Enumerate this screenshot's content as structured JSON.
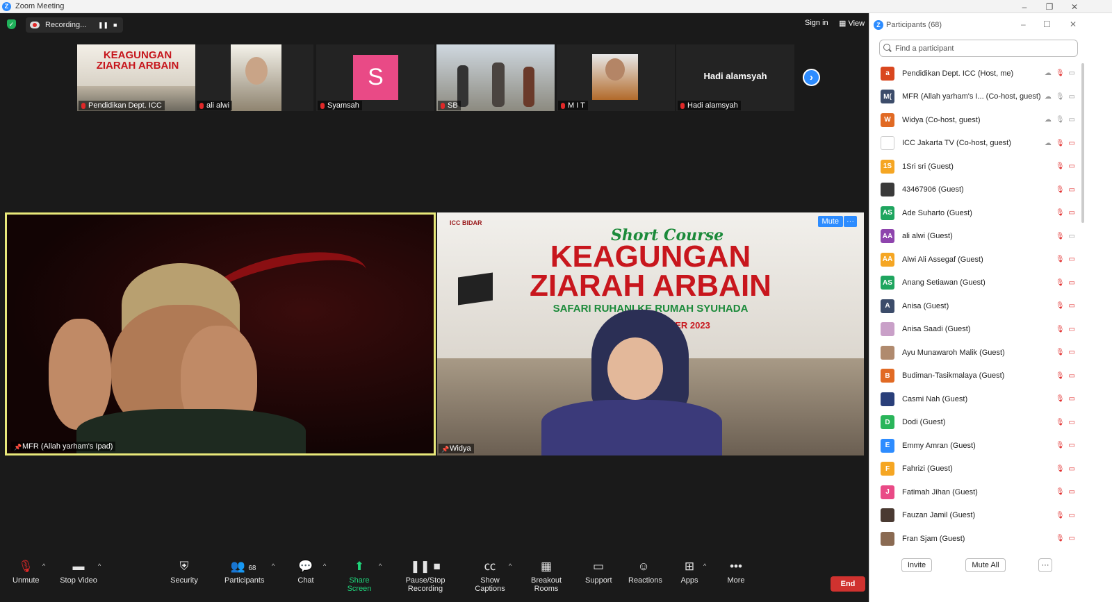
{
  "window": {
    "title": "Zoom Meeting"
  },
  "topbar": {
    "recording_label": "Recording...",
    "sign_in": "Sign in",
    "view": "View"
  },
  "strip_tiles": [
    {
      "name": "Pendidikan Dept. ICC",
      "banner_title": "KEAGUNGAN ZIARAH ARBAIN"
    },
    {
      "name": "ali alwi"
    },
    {
      "name": "Syamsah",
      "initial": "S",
      "color": "#e94a86"
    },
    {
      "name": "SB"
    },
    {
      "name": "M I T"
    },
    {
      "name": "Hadi alamsyah"
    }
  ],
  "speakers": {
    "left": {
      "name": "MFR (Allah yarham's Ipad)"
    },
    "right": {
      "name": "Widya",
      "mute_label": "Mute",
      "more_label": "···",
      "banner": {
        "logo": "ICC BIDAR",
        "script": "Short Course",
        "line1": "KEAGUNGAN",
        "line2": "ZIARAH ARBAIN",
        "subtitle": "SAFARI RUHANI KE RUMAH SYUHADA",
        "date": "MBER 2023"
      }
    }
  },
  "toolbar": {
    "unmute": "Unmute",
    "stop_video": "Stop Video",
    "security": "Security",
    "participants": "Participants",
    "participants_count": "68",
    "chat": "Chat",
    "share_screen": "Share Screen",
    "pause_recording": "Pause/Stop Recording",
    "show_captions": "Show Captions",
    "breakout_rooms": "Breakout Rooms",
    "support": "Support",
    "reactions": "Reactions",
    "apps": "Apps",
    "more": "More",
    "end": "End"
  },
  "panel": {
    "title": "Participants (68)",
    "search_placeholder": "Find a participant",
    "invite": "Invite",
    "mute_all": "Mute All",
    "more": "···",
    "participants": [
      {
        "name": "Pendidikan Dept. ICC (Host, me)",
        "initial": "a",
        "color": "#d9471f"
      },
      {
        "name": "MFR (Allah yarham's I... (Co-host, guest)",
        "initial": "M(",
        "color": "#3c4c6a"
      },
      {
        "name": "Widya (Co-host, guest)",
        "initial": "W",
        "color": "#e16a24"
      },
      {
        "name": "ICC Jakarta TV (Co-host, guest)",
        "initial": "",
        "color": "#ffffff"
      },
      {
        "name": "1Sri sri (Guest)",
        "initial": "1S",
        "color": "#f5a623"
      },
      {
        "name": "43467906 (Guest)",
        "initial": "",
        "color": "#3a3a3a"
      },
      {
        "name": "Ade Suharto (Guest)",
        "initial": "AS",
        "color": "#1fa55f"
      },
      {
        "name": "ali alwi (Guest)",
        "initial": "AA",
        "color": "#8e44ad"
      },
      {
        "name": "Alwi Ali Assegaf (Guest)",
        "initial": "AA",
        "color": "#f5a623"
      },
      {
        "name": "Anang Setiawan (Guest)",
        "initial": "AS",
        "color": "#1fa55f"
      },
      {
        "name": "Anisa (Guest)",
        "initial": "A",
        "color": "#3c4c6a"
      },
      {
        "name": "Anisa Saadi (Guest)",
        "initial": "",
        "color": "#c9a0c8"
      },
      {
        "name": "Ayu Munawaroh Malik (Guest)",
        "initial": "",
        "color": "#b08a6e"
      },
      {
        "name": "Budiman-Tasikmalaya (Guest)",
        "initial": "B",
        "color": "#e16a24"
      },
      {
        "name": "Casmi Nah (Guest)",
        "initial": "",
        "color": "#2a3f7a"
      },
      {
        "name": "Dodi (Guest)",
        "initial": "D",
        "color": "#2ab55a"
      },
      {
        "name": "Emmy Amran (Guest)",
        "initial": "E",
        "color": "#2d8cff"
      },
      {
        "name": "Fahrizi (Guest)",
        "initial": "F",
        "color": "#f5a623"
      },
      {
        "name": "Fatimah Jihan (Guest)",
        "initial": "J",
        "color": "#e94a86"
      },
      {
        "name": "Fauzan Jamil (Guest)",
        "initial": "",
        "color": "#4a3a32"
      },
      {
        "name": "Fran Sjam (Guest)",
        "initial": "",
        "color": "#8a6a52"
      }
    ]
  }
}
